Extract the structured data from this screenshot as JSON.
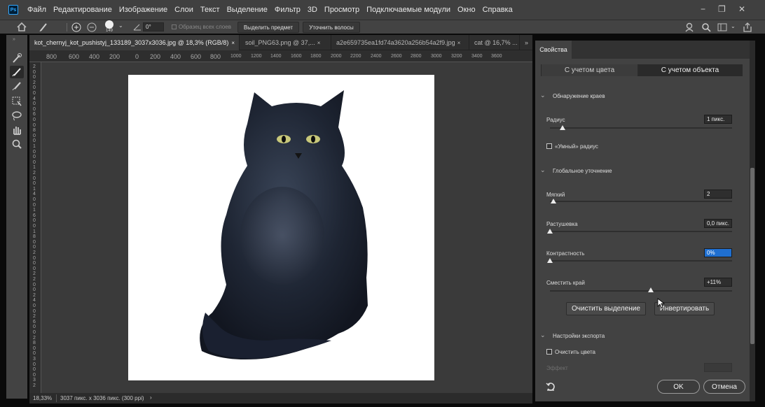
{
  "app": {
    "logo": "Ps"
  },
  "menu": [
    "Файл",
    "Редактирование",
    "Изображение",
    "Слои",
    "Текст",
    "Выделение",
    "Фильтр",
    "3D",
    "Просмотр",
    "Подключаемые модули",
    "Окно",
    "Справка"
  ],
  "options": {
    "brush_size": "149",
    "angle": "0°",
    "sample_all_layers": "Образец всех слоев",
    "select_subject": "Выделить предмет",
    "refine_hair": "Уточнить волосы"
  },
  "tabs": [
    {
      "label": "kot_chernyj_kot_pushistyj_133189_3037x3036.jpg @ 18,3% (RGB/8)",
      "close": "×",
      "active": true
    },
    {
      "label": "soil_PNG63.png @ 37,...",
      "close": "×",
      "active": false
    },
    {
      "label": "a2e659735ea1fd74a3620a256b54a2f9.jpg",
      "close": "×",
      "active": false
    },
    {
      "label": "cat @ 16,7% ...",
      "close": "",
      "active": false
    },
    {
      "label": "»",
      "close": "",
      "active": false
    }
  ],
  "ruler_h": [
    "800",
    "600",
    "400",
    "200",
    "0",
    "200",
    "400",
    "600",
    "800",
    "1000",
    "1200",
    "1400",
    "1600",
    "1800",
    "2000",
    "2200",
    "2400",
    "2600",
    "2800",
    "3000",
    "3200",
    "3400",
    "3600"
  ],
  "ruler_v": [
    "2",
    "0",
    "0",
    "2",
    "0",
    "0",
    "4",
    "0",
    "0",
    "6",
    "0",
    "0",
    "8",
    "0",
    "0",
    "1",
    "0",
    "0",
    "0",
    "1",
    "2",
    "0",
    "0",
    "1",
    "4",
    "0",
    "0",
    "1",
    "6",
    "0",
    "0",
    "1",
    "8",
    "0",
    "0",
    "2",
    "0",
    "0",
    "0",
    "2",
    "2",
    "0",
    "0",
    "2",
    "4",
    "0",
    "0",
    "2",
    "6",
    "0",
    "0",
    "2",
    "8",
    "0",
    "0",
    "3",
    "0",
    "0",
    "0",
    "3",
    "2"
  ],
  "status": {
    "zoom": "18,33%",
    "doc_info": "3037 пикс. x 3036 пикс. (300 ppi)",
    "arrow": "›"
  },
  "panel": {
    "title": "Свойства",
    "view_mode": {
      "color": "С учетом цвета",
      "object": "С учетом объекта",
      "active": "object"
    },
    "edge_detection": {
      "header": "Обнаружение краев",
      "radius_label": "Радиус",
      "radius_value": "1 пикс.",
      "radius_level": 0.07,
      "smart_radius": "«Умный» радиус"
    },
    "global_refinements": {
      "header": "Глобальное уточнение",
      "smooth_label": "Мягкий",
      "smooth_value": "2",
      "smooth_level": 0.02,
      "feather_label": "Растушевка",
      "feather_value": "0,0 пикс.",
      "feather_level": 0,
      "contrast_label": "Контрастность",
      "contrast_value": "0%",
      "contrast_level": 0,
      "shift_edge_label": "Сместить край",
      "shift_edge_value": "+11%",
      "shift_edge_level": 0.555
    },
    "clear_selection": "Очистить выделение",
    "invert": "Инвертировать",
    "output": {
      "header": "Настройки экспорта",
      "decontaminate": "Очистить цвета",
      "effect": "Эффект"
    },
    "ok": "OK",
    "cancel": "Отмена"
  },
  "colors": {
    "accent": "#1f6fd0",
    "panel_bg": "#424242",
    "canvas_bg": "#3a3a3a"
  },
  "icons": [
    "ps-logo-icon",
    "home-icon",
    "quick-select-icon",
    "add-selection-icon",
    "subtract-selection-icon",
    "brush-size-icon",
    "angle-icon",
    "search-icon",
    "workspace-icon",
    "share-icon",
    "reset-icon"
  ]
}
